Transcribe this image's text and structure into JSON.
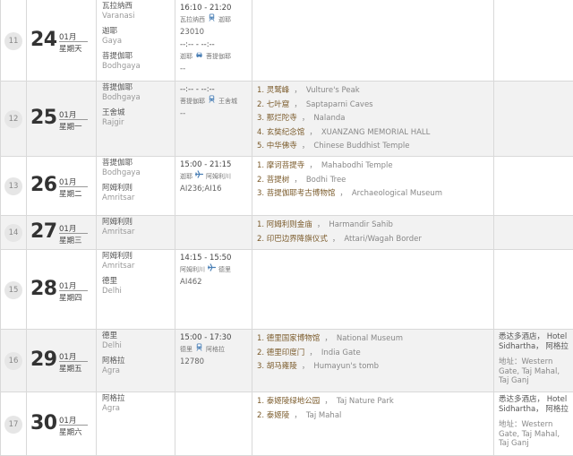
{
  "rows": [
    {
      "index": "11",
      "day": "24",
      "month": "01月",
      "weekday": "星期天",
      "cities": [
        {
          "cn": "瓦拉纳西",
          "en": "Varanasi"
        },
        {
          "cn": "迦耶",
          "en": "Gaya"
        },
        {
          "cn": "菩提伽耶",
          "en": "Bodhgaya"
        }
      ],
      "transports": [
        {
          "time": "16:10 - 21:20",
          "from": "瓦拉纳西",
          "to": "迦耶",
          "icon": "train-icon",
          "code": "23010"
        },
        {
          "time": "--:-- - --:--",
          "from": "迦耶",
          "to": "菩提伽耶",
          "icon": "car-icon",
          "code": "--"
        }
      ],
      "sights": [],
      "hotel": null
    },
    {
      "index": "12",
      "day": "25",
      "month": "01月",
      "weekday": "星期一",
      "cities": [
        {
          "cn": "菩提伽耶",
          "en": "Bodhgaya"
        },
        {
          "cn": "王舍城",
          "en": "Rajgir"
        }
      ],
      "transports": [
        {
          "time": "--:-- - --:--",
          "from": "菩提伽耶",
          "to": "王舍城",
          "icon": "train-icon",
          "code": "--"
        }
      ],
      "sights": [
        {
          "cn": "1. 灵鹫峰",
          "en": "Vulture's Peak"
        },
        {
          "cn": "2. 七叶窟",
          "en": "Saptaparni Caves"
        },
        {
          "cn": "3. 那烂陀寺",
          "en": "Nalanda"
        },
        {
          "cn": "4. 玄奘纪念馆",
          "en": "XUANZANG MEMORIAL HALL"
        },
        {
          "cn": "5. 中华佛寺",
          "en": "Chinese Buddhist Temple"
        }
      ],
      "hotel": null
    },
    {
      "index": "13",
      "day": "26",
      "month": "01月",
      "weekday": "星期二",
      "cities": [
        {
          "cn": "菩提伽耶",
          "en": "Bodhgaya"
        },
        {
          "cn": "阿姆利则",
          "en": "Amritsar"
        }
      ],
      "transports": [
        {
          "time": "15:00 - 21:15",
          "from": "迦耶",
          "to": "阿姆利川",
          "icon": "plane-icon",
          "code": "AI236;AI16"
        }
      ],
      "sights": [
        {
          "cn": "1. 摩诃菩提寺",
          "en": "Mahabodhi Temple"
        },
        {
          "cn": "2. 菩提树",
          "en": "Bodhi Tree"
        },
        {
          "cn": "3. 菩提伽耶考古博物馆",
          "en": "Archaeological Museum"
        }
      ],
      "hotel": null
    },
    {
      "index": "14",
      "day": "27",
      "month": "01月",
      "weekday": "星期三",
      "cities": [
        {
          "cn": "阿姆利则",
          "en": "Amritsar"
        }
      ],
      "transports": [],
      "sights": [
        {
          "cn": "1. 阿姆利则金庙",
          "en": "Harmandir Sahib"
        },
        {
          "cn": "2. 印巴边界降旗仪式",
          "en": "Attari/Wagah Border"
        }
      ],
      "hotel": null
    },
    {
      "index": "15",
      "day": "28",
      "month": "01月",
      "weekday": "星期四",
      "cities": [
        {
          "cn": "阿姆利则",
          "en": "Amritsar"
        },
        {
          "cn": "德里",
          "en": "Delhi"
        }
      ],
      "transports": [
        {
          "time": "14:15 - 15:50",
          "from": "阿姆利川",
          "to": "德里",
          "icon": "plane-icon",
          "code": "AI462"
        }
      ],
      "sights": [],
      "hotel": null
    },
    {
      "index": "16",
      "day": "29",
      "month": "01月",
      "weekday": "星期五",
      "cities": [
        {
          "cn": "德里",
          "en": "Delhi"
        },
        {
          "cn": "阿格拉",
          "en": "Agra"
        }
      ],
      "transports": [
        {
          "time": "15:00 - 17:30",
          "from": "德里",
          "to": "阿格拉",
          "icon": "train-icon",
          "code": "12780"
        }
      ],
      "sights": [
        {
          "cn": "1. 德里国家博物馆",
          "en": "National Museum"
        },
        {
          "cn": "2. 德里印度门",
          "en": "India Gate"
        },
        {
          "cn": "3. 胡马雍陵",
          "en": "Humayun's tomb"
        }
      ],
      "hotel": {
        "name": "悉达多酒店， Hotel Sidhartha， 阿格拉",
        "address": "地址：Western Gate, Taj Mahal, Taj Ganj"
      }
    },
    {
      "index": "17",
      "day": "30",
      "month": "01月",
      "weekday": "星期六",
      "cities": [
        {
          "cn": "阿格拉",
          "en": "Agra"
        }
      ],
      "transports": [],
      "sights": [
        {
          "cn": "1. 泰姬陵绿地公园",
          "en": "Taj Nature Park"
        },
        {
          "cn": "2. 泰姬陵",
          "en": "Taj Mahal"
        }
      ],
      "hotel": {
        "name": "悉达多酒店， Hotel Sidhartha， 阿格拉",
        "address": "地址：Western Gate, Taj Mahal, Taj Ganj"
      }
    }
  ],
  "separator": "，"
}
